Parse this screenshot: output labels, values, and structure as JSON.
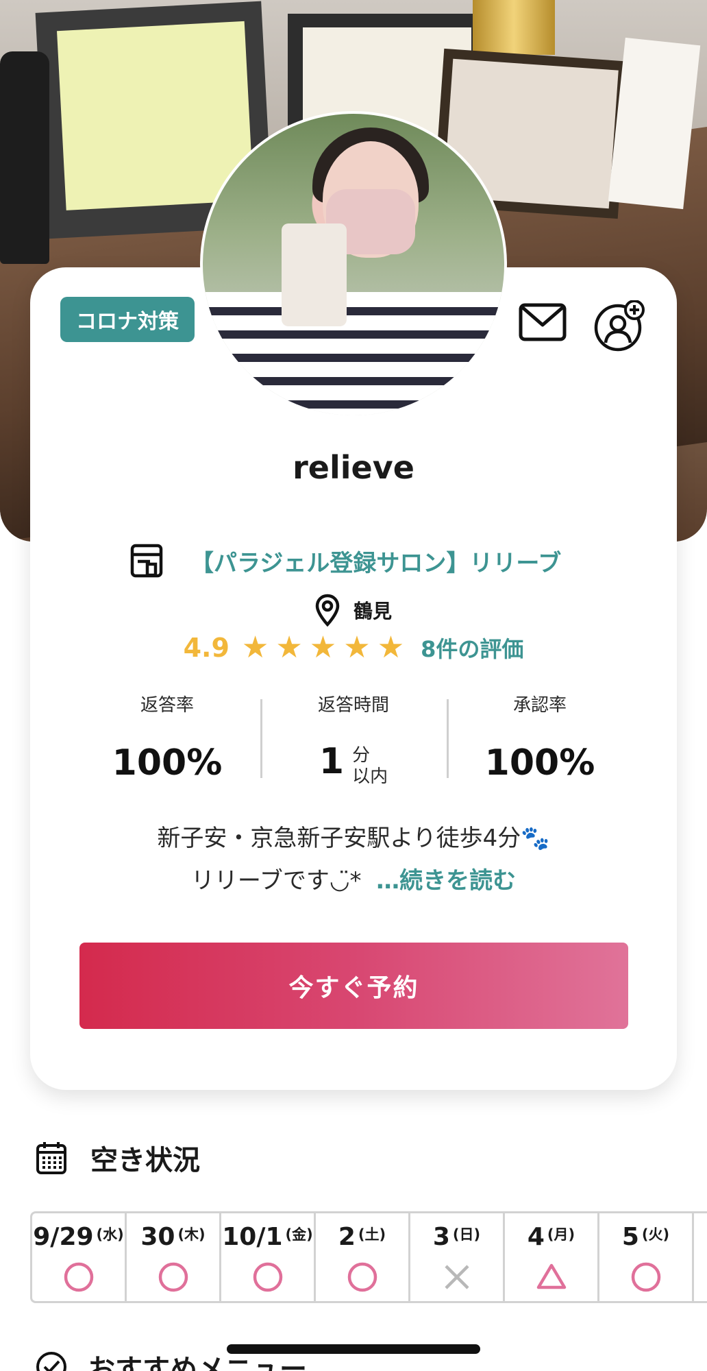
{
  "hero": {
    "photo_alt": "salon-photo"
  },
  "profile": {
    "badge": "コロナ対策",
    "name": "relieve",
    "salon_name": "【パラジェル登録サロン】リリーブ",
    "area": "鶴見",
    "rating": {
      "value": "4.9",
      "stars": 5,
      "count_label": "8件の評価"
    },
    "stats": {
      "response_rate_label": "返答率",
      "response_rate_value": "100%",
      "response_time_label": "返答時間",
      "response_time_value": "1",
      "response_time_unit_1": "分",
      "response_time_unit_2": "以内",
      "approval_rate_label": "承認率",
      "approval_rate_value": "100%"
    },
    "description_line1": "新子安・京急新子安駅より徒歩4分🐾",
    "description_line2": "リリーブです◡̈*",
    "read_more": "…続きを読む",
    "reserve_button": "今すぐ予約",
    "icons": {
      "mail": "mail-icon",
      "follow": "add-user-icon",
      "salon": "shop-icon",
      "location": "location-pin-icon",
      "star": "star-icon"
    }
  },
  "availability": {
    "title": "空き状況",
    "icon": "calendar-icon",
    "days": [
      {
        "date": "9/29",
        "weekday": "(水)",
        "status": "available"
      },
      {
        "date": "30",
        "weekday": "(木)",
        "status": "available"
      },
      {
        "date": "10/1",
        "weekday": "(金)",
        "status": "available"
      },
      {
        "date": "2",
        "weekday": "(土)",
        "status": "available"
      },
      {
        "date": "3",
        "weekday": "(日)",
        "status": "unavailable"
      },
      {
        "date": "4",
        "weekday": "(月)",
        "status": "limited"
      },
      {
        "date": "5",
        "weekday": "(火)",
        "status": "available"
      }
    ]
  },
  "recommend": {
    "title": "おすすめメニュー",
    "icon": "check-badge-icon"
  },
  "colors": {
    "accent": "#3d9492",
    "star": "#f2b73a",
    "cta_start": "#d42a4d",
    "cta_end": "#e07399",
    "available": "#e0709a",
    "unavailable": "#b8b8b8"
  }
}
